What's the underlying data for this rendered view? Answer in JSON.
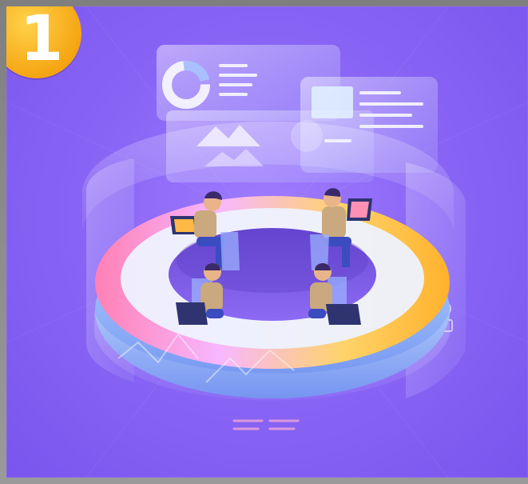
{
  "badge": {
    "number": "1",
    "color": "#f5a512"
  },
  "scene": {
    "description_icons": [
      "donut-chart-icon",
      "mountain-chart-icon",
      "document-panel-icon",
      "laptop-icon",
      "chair-icon"
    ],
    "colors": {
      "background": "#8a66f6",
      "ring_pink": "#ff7fb0",
      "ring_yellow": "#ffc94a",
      "ring_blue": "#7fd3ff",
      "panel": "#cfe6ff",
      "shirt": "#c9a97d",
      "pants": "#3b4cc0",
      "hair": "#3a2a6a",
      "laptop": "#2f3470"
    },
    "people_count": 4
  }
}
